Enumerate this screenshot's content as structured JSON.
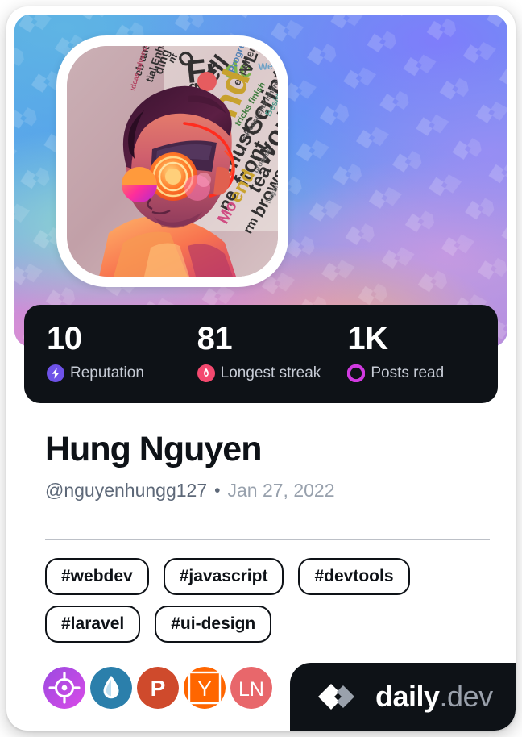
{
  "card": {
    "type": "devcard",
    "brand": {
      "logo_icon": "daily-dev-chevron-logo-icon",
      "name": "daily",
      "suffix": ".dev",
      "plate_color": "#0e1217"
    },
    "cover": {
      "watermark_icon": "daily-dev-chevron-pattern-icon",
      "gradient_colors": [
        "#57a9e2",
        "#4f9bf0",
        "#8ed8cf",
        "#b98ce0",
        "#f4b183",
        "#7f7dfb"
      ]
    },
    "avatar": {
      "icon": "user-avatar",
      "alt": "AI generated portrait with word-cloud background",
      "frame_color": "#ffffff"
    },
    "stats": [
      {
        "value": "10",
        "label": "Reputation",
        "icon": "bolt-icon",
        "color": "#6e52e8"
      },
      {
        "value": "81",
        "label": "Longest streak",
        "icon": "flame-icon",
        "color": "#f4496f"
      },
      {
        "value": "1K",
        "label": "Posts read",
        "icon": "ring-icon",
        "color": "#d13ae0"
      }
    ],
    "stats_bar_color": "#0e1217",
    "identity": {
      "name": "Hung Nguyen",
      "handle": "@nguyenhungg127",
      "separator": "•",
      "joined": "Jan 27, 2022"
    },
    "tags": [
      "#webdev",
      "#javascript",
      "#devtools",
      "#laravel",
      "#ui-design"
    ],
    "source_badges": [
      {
        "name": "target-badge-icon",
        "glyph": "",
        "colors": [
          "#9b4ae0",
          "#d44ae8"
        ]
      },
      {
        "name": "water-drop-badge-icon",
        "glyph": "",
        "colors": [
          "#2b7fab",
          "#2b7fab"
        ]
      },
      {
        "name": "product-hunt-badge-icon",
        "glyph": "P",
        "colors": [
          "#cf4a2c",
          "#cf4a2c"
        ]
      },
      {
        "name": "hacker-news-badge-icon",
        "glyph": "Y",
        "colors": [
          "#ff6600",
          "#ff6600"
        ]
      },
      {
        "name": "ln-badge-icon",
        "glyph": "LN",
        "colors": [
          "#e8676b",
          "#e8676b"
        ]
      }
    ]
  }
}
